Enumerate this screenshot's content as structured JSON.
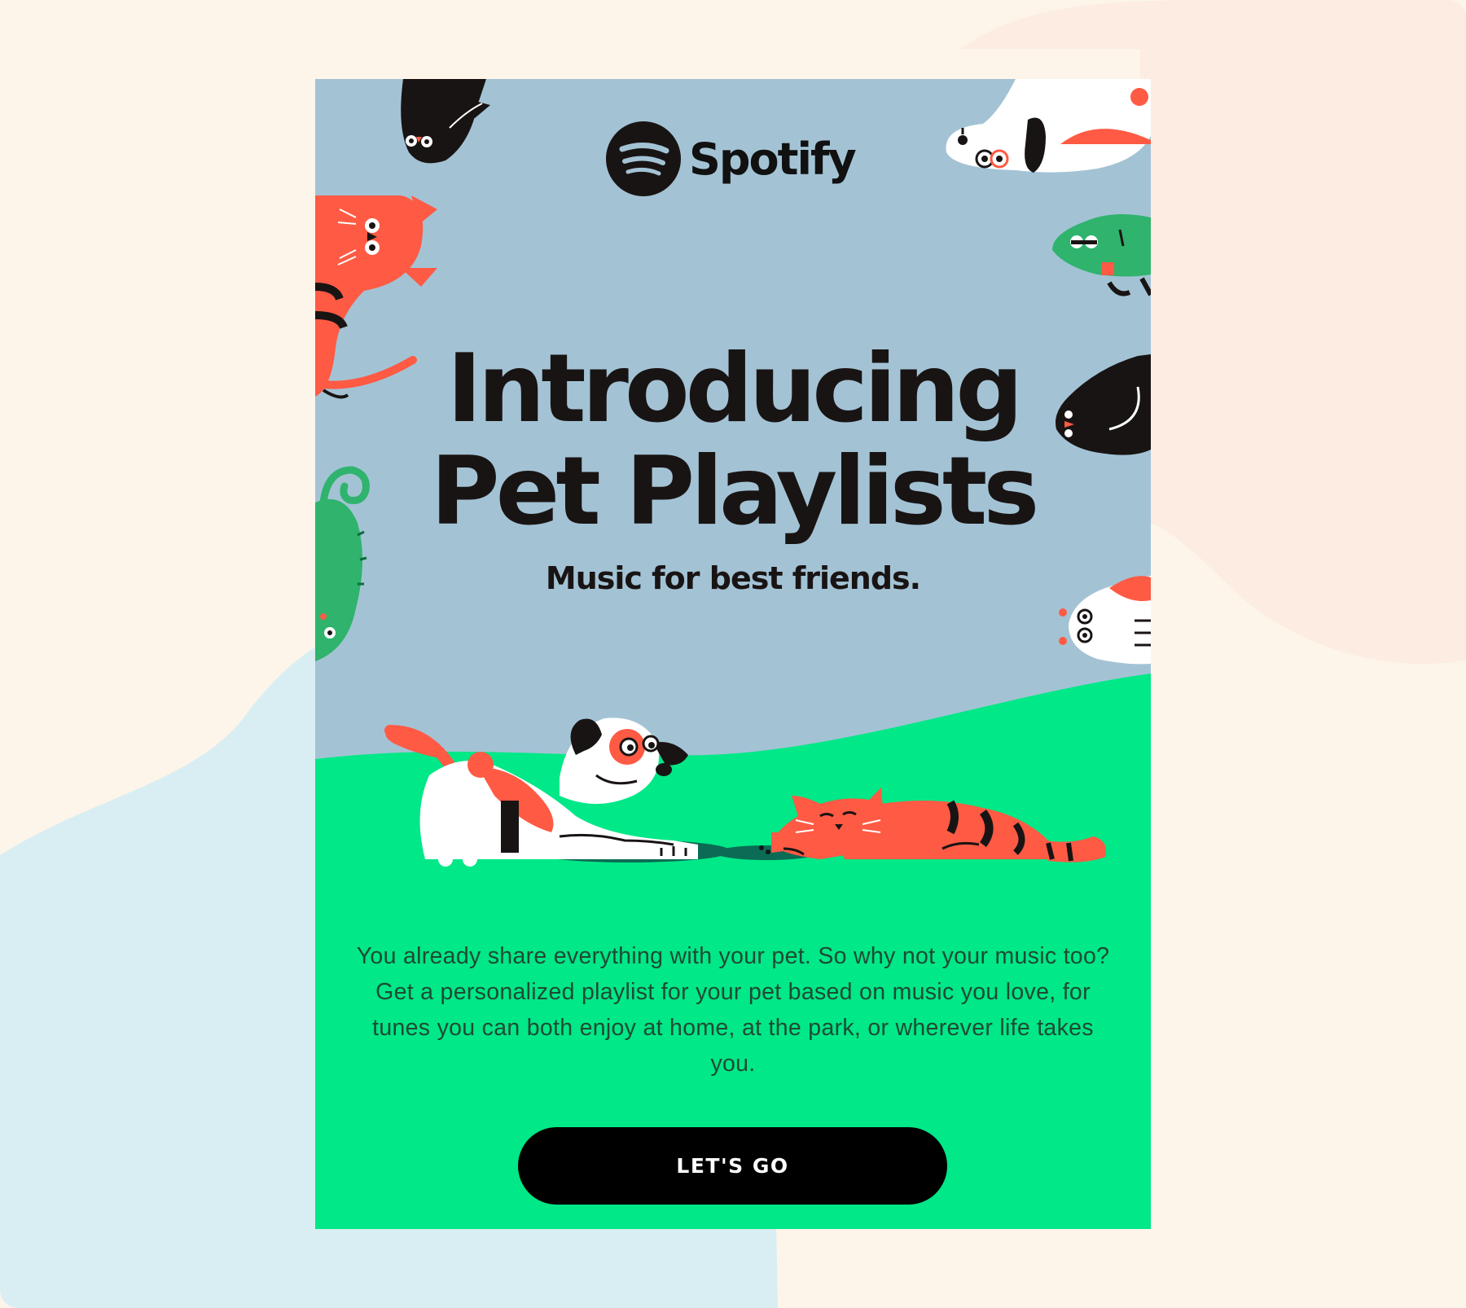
{
  "brand": {
    "name": "Spotify",
    "logo_icon": "spotify-logo-icon"
  },
  "hero": {
    "headline_line1": "Introducing",
    "headline_line2": "Pet Playlists",
    "subhead": "Music for best friends."
  },
  "body": {
    "paragraph": "You already share everything with your pet. So why not your music too? Get a personalized playlist for your pet based on music you love, for tunes you can both enjoy at home, at the park, or wherever life takes you."
  },
  "cta": {
    "label": "LET'S GO"
  },
  "colors": {
    "page_background": "#fdf5ea",
    "blob_blue": "#d9eef2",
    "blob_peach": "#fcece2",
    "sky": "#a3c3d5",
    "grass": "#00e887",
    "pet_red": "#ff5a44",
    "pet_black": "#191414",
    "pet_green": "#2fb36d",
    "button": "#000000",
    "button_text": "#ffffff"
  },
  "illustrations": [
    "dog-illustration",
    "cat-illustration",
    "corner-pets-illustration"
  ]
}
